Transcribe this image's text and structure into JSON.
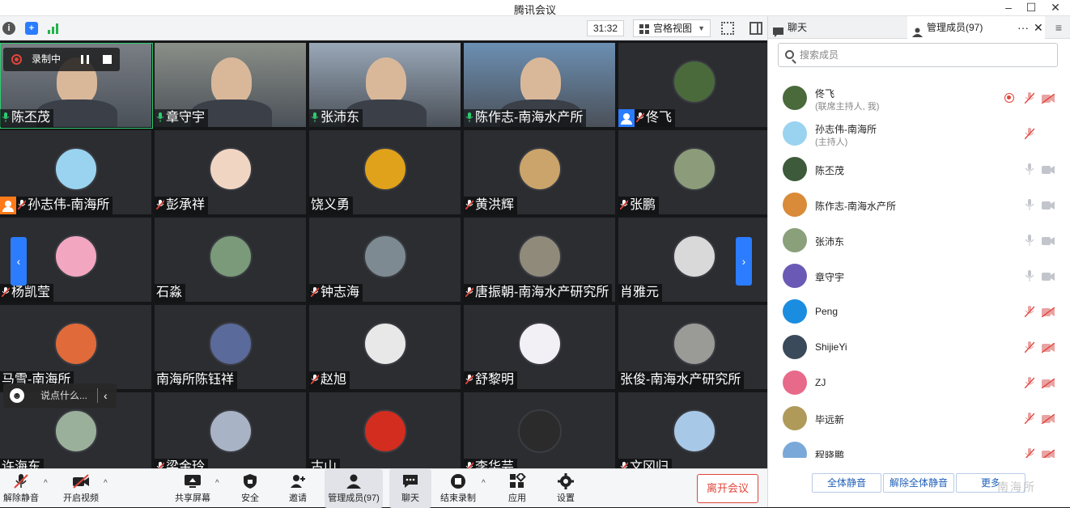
{
  "window": {
    "title": "腾讯会议"
  },
  "topbar": {
    "timer": "31:32",
    "view_label": "宫格视图"
  },
  "recording": {
    "label": "录制中"
  },
  "tiles": [
    {
      "name": "陈丕茂",
      "type": "video",
      "icon": "mic-on",
      "bg": "#7a7f86"
    },
    {
      "name": "章守宇",
      "type": "video",
      "icon": "mic-on",
      "bg": "#8a8f88"
    },
    {
      "name": "张沛东",
      "type": "video",
      "icon": "mic-on",
      "bg": "#9aa8b8"
    },
    {
      "name": "陈作志-南海水产所",
      "type": "video",
      "icon": "mic-on",
      "bg": "#6c8fb3"
    },
    {
      "name": "佟飞",
      "type": "avatar",
      "icon": "mic-muted",
      "host": "blue",
      "avatar": "#4a6a3c"
    },
    {
      "name": "孙志伟-南海所",
      "type": "avatar",
      "icon": "mic-muted",
      "host": "orange",
      "avatar": "#9ad3f0"
    },
    {
      "name": "彭承祥",
      "type": "avatar",
      "icon": "mic-muted",
      "avatar": "#f1d5c3"
    },
    {
      "name": "饶义勇",
      "type": "avatar",
      "icon": "none",
      "avatar": "#e0a21a"
    },
    {
      "name": "黄洪辉",
      "type": "avatar",
      "icon": "mic-muted",
      "avatar": "#caa46a"
    },
    {
      "name": "张鹏",
      "type": "avatar",
      "icon": "mic-muted",
      "avatar": "#8c9c7a"
    },
    {
      "name": "杨凯莹",
      "type": "avatar",
      "icon": "mic-muted",
      "avatar": "#f3a6c0"
    },
    {
      "name": "石淼",
      "type": "avatar",
      "icon": "none",
      "avatar": "#7a9a7a"
    },
    {
      "name": "钟志海",
      "type": "avatar",
      "icon": "mic-muted",
      "avatar": "#7d8a92"
    },
    {
      "name": "唐振朝-南海水产研究所",
      "type": "avatar",
      "icon": "mic-muted",
      "avatar": "#8f8a7a"
    },
    {
      "name": "肖雅元",
      "type": "avatar",
      "icon": "none",
      "avatar": "#d9d9d9"
    },
    {
      "name": "马雪-南海所",
      "type": "avatar",
      "icon": "none",
      "avatar": "#e06a3a"
    },
    {
      "name": "南海所陈钰祥",
      "type": "avatar",
      "icon": "none",
      "avatar": "#5a6a9a"
    },
    {
      "name": "赵旭",
      "type": "avatar",
      "icon": "mic-muted",
      "avatar": "#e8e8e8"
    },
    {
      "name": "舒黎明",
      "type": "avatar",
      "icon": "mic-muted",
      "avatar": "#f2f0f5"
    },
    {
      "name": "张俊-南海水产研究所",
      "type": "avatar",
      "icon": "none",
      "avatar": "#9a9a96"
    },
    {
      "name": "许海东",
      "type": "avatar",
      "icon": "none",
      "avatar": "#9ab09a"
    },
    {
      "name": "梁金玲",
      "type": "avatar",
      "icon": "mic-muted",
      "avatar": "#a9b3c6"
    },
    {
      "name": "古山",
      "type": "avatar",
      "icon": "none",
      "avatar": "#d22d1f"
    },
    {
      "name": "李华芸",
      "type": "avatar",
      "icon": "mic-muted",
      "avatar": "#2b2b2b"
    },
    {
      "name": "文冈归",
      "type": "avatar",
      "icon": "mic-muted",
      "avatar": "#a8c8e8"
    }
  ],
  "chat_popup": {
    "placeholder": "说点什么..."
  },
  "toolbar": {
    "unmute": "解除静音",
    "video": "开启视频",
    "share": "共享屏幕",
    "security": "安全",
    "invite": "邀请",
    "members": "管理成员(97)",
    "chat": "聊天",
    "end_record": "结束录制",
    "apps": "应用",
    "settings": "设置",
    "leave": "离开会议"
  },
  "panel": {
    "tab_chat": "聊天",
    "tab_members": "管理成员(97)",
    "search_placeholder": "搜索成员",
    "members": [
      {
        "name": "佟飞",
        "role": "(联席主持人, 我)",
        "avatar": "#4a6a3c",
        "rec": true,
        "mic": "muted-red",
        "cam": "off-red"
      },
      {
        "name": "孙志伟-南海所",
        "role": "(主持人)",
        "avatar": "#9ad3f0",
        "rec": false,
        "mic": "muted-red",
        "cam": "none"
      },
      {
        "name": "陈丕茂",
        "role": "",
        "avatar": "#3d5a3a",
        "rec": false,
        "mic": "on",
        "cam": "on"
      },
      {
        "name": "陈作志-南海水产所",
        "role": "",
        "avatar": "#d98b3a",
        "rec": false,
        "mic": "on",
        "cam": "on"
      },
      {
        "name": "张沛东",
        "role": "",
        "avatar": "#8aa07a",
        "rec": false,
        "mic": "on",
        "cam": "on"
      },
      {
        "name": "章守宇",
        "role": "",
        "avatar": "#6a5ab5",
        "rec": false,
        "mic": "on",
        "cam": "on"
      },
      {
        "name": "Peng",
        "role": "",
        "avatar": "#1a8de0",
        "rec": false,
        "mic": "muted-red",
        "cam": "off-red"
      },
      {
        "name": "ShijieYi",
        "role": "",
        "avatar": "#3a4a5a",
        "rec": false,
        "mic": "muted-red",
        "cam": "off-red"
      },
      {
        "name": "ZJ",
        "role": "",
        "avatar": "#e86a8a",
        "rec": false,
        "mic": "muted-red",
        "cam": "off-red"
      },
      {
        "name": "毕远新",
        "role": "",
        "avatar": "#b09a5a",
        "rec": false,
        "mic": "muted-red",
        "cam": "off-red"
      },
      {
        "name": "程晓鹏",
        "role": "",
        "avatar": "#7aa8d8",
        "rec": false,
        "mic": "muted-red",
        "cam": "off-red"
      }
    ],
    "mute_all": "全体静音",
    "unmute_all": "解除全体静音",
    "more": "更多"
  },
  "watermark": "南海所",
  "colors": {
    "accent": "#2b7cff",
    "danger": "#e0443a",
    "host_badge": "#ff7a1a"
  }
}
